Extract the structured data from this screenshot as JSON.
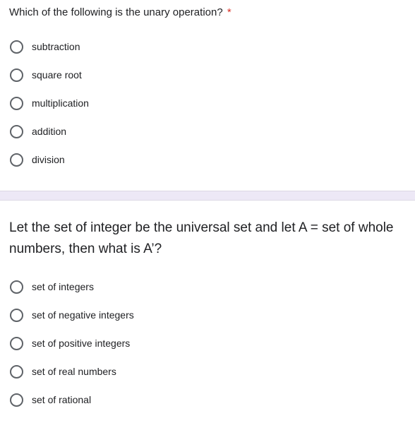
{
  "question1": {
    "title": "Which of the following is the unary operation?",
    "required_marker": "*",
    "options": [
      {
        "label": "subtraction",
        "selected": false
      },
      {
        "label": "square root",
        "selected": false
      },
      {
        "label": "multiplication",
        "selected": false
      },
      {
        "label": "addition",
        "selected": false
      },
      {
        "label": "division",
        "selected": false
      }
    ]
  },
  "question2": {
    "title": "Let the set of integer be the universal set and let A = set of whole numbers, then what is A’?",
    "options": [
      {
        "label": "set of integers",
        "selected": false
      },
      {
        "label": "set of negative integers",
        "selected": false
      },
      {
        "label": "set of positive integers",
        "selected": false
      },
      {
        "label": "set of real numbers",
        "selected": false
      },
      {
        "label": "set of rational",
        "selected": false
      }
    ]
  },
  "colors": {
    "required": "#d93025",
    "radio_border": "#5f6368",
    "separator": "#ede8f6",
    "text": "#202124"
  }
}
